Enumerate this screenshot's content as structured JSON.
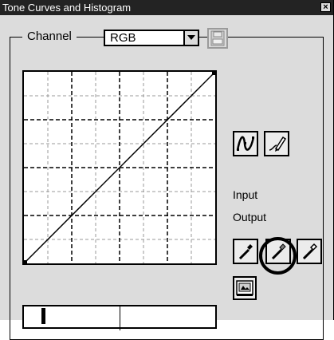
{
  "window": {
    "title": "Tone Curves and Histogram",
    "close_glyph": "×"
  },
  "channel": {
    "label": "Channel",
    "selected": "RGB"
  },
  "buttons": {
    "save_icon": "save-curve-icon",
    "curve_mode_icon": "curve-mode-icon",
    "freehand_mode_icon": "pencil-icon",
    "black_point_icon": "black-eyedropper-icon",
    "gray_point_icon": "gray-eyedropper-icon",
    "white_point_icon": "white-eyedropper-icon",
    "preview_icon": "preview-icon"
  },
  "readout": {
    "input_label": "Input",
    "output_label": "Output"
  },
  "colors": {
    "title_bar": "#232323",
    "panel": "#dcdcdc",
    "annotation": "#000000"
  }
}
